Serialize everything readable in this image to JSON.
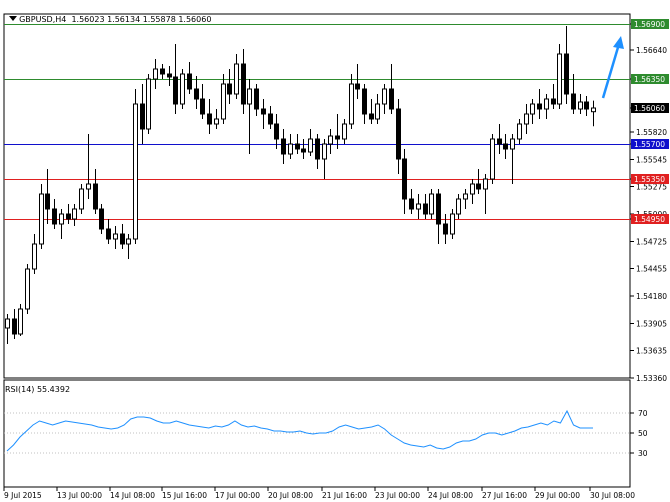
{
  "header": {
    "symbol": "GBPUSD,H4",
    "ohlc": "1.56023 1.56134 1.55878 1.56060"
  },
  "rsi": {
    "label": "RSI(14) 55.4392"
  },
  "colors": {
    "green_line": "#2e8b2e",
    "blue_line": "#1010cc",
    "red_line": "#e02020",
    "rsi_line": "#1e90ff",
    "arrow": "#1e90ff",
    "candle": "#000000",
    "grid": "#c0c0c0"
  },
  "chart_data": [
    {
      "type": "candlestick",
      "title": "GBPUSD,H4",
      "ylim": [
        1.5336,
        1.57
      ],
      "y_ticks": [
        "1.56900",
        "1.56640",
        "1.56350",
        "1.56060",
        "1.55820",
        "1.55700",
        "1.55545",
        "1.55350",
        "1.55275",
        "1.55000",
        "1.54950",
        "1.54725",
        "1.54455",
        "1.54180",
        "1.53905",
        "1.53635",
        "1.53360"
      ],
      "x_ticks": [
        "9 Jul 2015",
        "13 Jul 00:00",
        "14 Jul 08:00",
        "15 Jul 16:00",
        "17 Jul 00:00",
        "20 Jul 08:00",
        "21 Jul 16:00",
        "23 Jul 00:00",
        "24 Jul 08:00",
        "27 Jul 16:00",
        "29 Jul 00:00",
        "30 Jul 08:00"
      ],
      "levels": [
        {
          "value": 1.569,
          "label": "1.56900",
          "color": "green"
        },
        {
          "value": 1.5635,
          "label": "1.56350",
          "color": "green"
        },
        {
          "value": 1.557,
          "label": "1.55700",
          "color": "blue"
        },
        {
          "value": 1.5535,
          "label": "1.55350",
          "color": "red"
        },
        {
          "value": 1.5495,
          "label": "1.54950",
          "color": "red"
        }
      ],
      "current_price": {
        "value": 1.5606,
        "label": "1.56060"
      },
      "candles": [
        [
          1.5386,
          1.54,
          1.537,
          1.5395
        ],
        [
          1.5395,
          1.5405,
          1.5375,
          1.538
        ],
        [
          1.538,
          1.541,
          1.5378,
          1.5405
        ],
        [
          1.5405,
          1.545,
          1.54,
          1.5445
        ],
        [
          1.5445,
          1.548,
          1.544,
          1.547
        ],
        [
          1.547,
          1.553,
          1.5465,
          1.552
        ],
        [
          1.552,
          1.5545,
          1.549,
          1.5505
        ],
        [
          1.5505,
          1.5515,
          1.5485,
          1.549
        ],
        [
          1.549,
          1.5505,
          1.5475,
          1.55
        ],
        [
          1.55,
          1.551,
          1.549,
          1.5495
        ],
        [
          1.5495,
          1.551,
          1.5488,
          1.5505
        ],
        [
          1.5505,
          1.553,
          1.55,
          1.5525
        ],
        [
          1.5525,
          1.558,
          1.5515,
          1.553
        ],
        [
          1.553,
          1.5545,
          1.55,
          1.5505
        ],
        [
          1.5505,
          1.551,
          1.548,
          1.5485
        ],
        [
          1.5485,
          1.5495,
          1.547,
          1.5475
        ],
        [
          1.5475,
          1.5488,
          1.5465,
          1.548
        ],
        [
          1.548,
          1.549,
          1.5465,
          1.547
        ],
        [
          1.547,
          1.548,
          1.5455,
          1.5475
        ],
        [
          1.5475,
          1.5625,
          1.547,
          1.561
        ],
        [
          1.561,
          1.563,
          1.557,
          1.5585
        ],
        [
          1.5585,
          1.564,
          1.558,
          1.5635
        ],
        [
          1.5635,
          1.5655,
          1.5625,
          1.5645
        ],
        [
          1.5645,
          1.565,
          1.5635,
          1.564
        ],
        [
          1.564,
          1.5648,
          1.5628,
          1.5637
        ],
        [
          1.5637,
          1.567,
          1.56,
          1.561
        ],
        [
          1.561,
          1.5645,
          1.5605,
          1.564
        ],
        [
          1.564,
          1.5652,
          1.562,
          1.5625
        ],
        [
          1.5625,
          1.5638,
          1.5605,
          1.5615
        ],
        [
          1.5615,
          1.563,
          1.5595,
          1.56
        ],
        [
          1.56,
          1.5615,
          1.558,
          1.559
        ],
        [
          1.559,
          1.5605,
          1.5585,
          1.5595
        ],
        [
          1.5595,
          1.564,
          1.559,
          1.563
        ],
        [
          1.563,
          1.5645,
          1.561,
          1.562
        ],
        [
          1.562,
          1.566,
          1.5615,
          1.565
        ],
        [
          1.565,
          1.5665,
          1.56,
          1.561
        ],
        [
          1.561,
          1.5635,
          1.556,
          1.5625
        ],
        [
          1.5625,
          1.563,
          1.5598,
          1.5605
        ],
        [
          1.5605,
          1.5615,
          1.5585,
          1.56
        ],
        [
          1.56,
          1.5608,
          1.5585,
          1.559
        ],
        [
          1.559,
          1.56,
          1.5565,
          1.5575
        ],
        [
          1.5575,
          1.5585,
          1.555,
          1.556
        ],
        [
          1.556,
          1.558,
          1.5555,
          1.557
        ],
        [
          1.557,
          1.558,
          1.556,
          1.5565
        ],
        [
          1.5565,
          1.5575,
          1.5555,
          1.5562
        ],
        [
          1.5562,
          1.5585,
          1.5558,
          1.5575
        ],
        [
          1.5575,
          1.558,
          1.5545,
          1.5555
        ],
        [
          1.5555,
          1.5575,
          1.5535,
          1.557
        ],
        [
          1.557,
          1.5585,
          1.556,
          1.5578
        ],
        [
          1.5578,
          1.56,
          1.5565,
          1.5575
        ],
        [
          1.5575,
          1.5595,
          1.557,
          1.559
        ],
        [
          1.559,
          1.564,
          1.5585,
          1.563
        ],
        [
          1.563,
          1.565,
          1.5615,
          1.5625
        ],
        [
          1.5625,
          1.563,
          1.559,
          1.56
        ],
        [
          1.56,
          1.5615,
          1.559,
          1.5595
        ],
        [
          1.5595,
          1.562,
          1.559,
          1.561
        ],
        [
          1.561,
          1.563,
          1.56,
          1.5625
        ],
        [
          1.5625,
          1.565,
          1.56,
          1.5605
        ],
        [
          1.5605,
          1.5615,
          1.554,
          1.5555
        ],
        [
          1.5555,
          1.5565,
          1.55,
          1.5515
        ],
        [
          1.5515,
          1.5525,
          1.55,
          1.5505
        ],
        [
          1.5505,
          1.552,
          1.5495,
          1.551
        ],
        [
          1.551,
          1.552,
          1.5495,
          1.55
        ],
        [
          1.55,
          1.5525,
          1.5495,
          1.552
        ],
        [
          1.552,
          1.5525,
          1.547,
          1.549
        ],
        [
          1.549,
          1.55,
          1.547,
          1.548
        ],
        [
          1.548,
          1.5505,
          1.5475,
          1.55
        ],
        [
          1.55,
          1.552,
          1.5495,
          1.5515
        ],
        [
          1.5515,
          1.5525,
          1.5505,
          1.552
        ],
        [
          1.552,
          1.5535,
          1.551,
          1.553
        ],
        [
          1.553,
          1.5545,
          1.552,
          1.5525
        ],
        [
          1.5525,
          1.554,
          1.55,
          1.5535
        ],
        [
          1.5535,
          1.558,
          1.553,
          1.5575
        ],
        [
          1.5575,
          1.559,
          1.556,
          1.557
        ],
        [
          1.557,
          1.558,
          1.5555,
          1.5565
        ],
        [
          1.5565,
          1.558,
          1.553,
          1.5575
        ],
        [
          1.5575,
          1.5595,
          1.557,
          1.559
        ],
        [
          1.559,
          1.561,
          1.558,
          1.56
        ],
        [
          1.56,
          1.5615,
          1.559,
          1.561
        ],
        [
          1.561,
          1.5625,
          1.5595,
          1.5605
        ],
        [
          1.5605,
          1.562,
          1.5595,
          1.5615
        ],
        [
          1.5615,
          1.563,
          1.5605,
          1.561
        ],
        [
          1.561,
          1.567,
          1.5605,
          1.566
        ],
        [
          1.566,
          1.5688,
          1.561,
          1.562
        ],
        [
          1.562,
          1.564,
          1.56,
          1.5605
        ],
        [
          1.5605,
          1.562,
          1.56,
          1.5612
        ],
        [
          1.5612,
          1.5618,
          1.5598,
          1.5605
        ],
        [
          1.56023,
          1.56134,
          1.55878,
          1.5606
        ]
      ]
    },
    {
      "type": "line",
      "title": "RSI(14) 55.4392",
      "ylim": [
        0,
        100
      ],
      "y_ticks": [
        "70",
        "50",
        "30"
      ],
      "values": [
        32,
        38,
        46,
        52,
        58,
        62,
        60,
        58,
        60,
        62,
        61,
        60,
        59,
        58,
        56,
        55,
        54,
        55,
        58,
        64,
        66,
        66,
        65,
        62,
        60,
        60,
        62,
        60,
        58,
        57,
        56,
        55,
        57,
        56,
        58,
        62,
        58,
        56,
        57,
        55,
        54,
        52,
        52,
        51,
        51,
        52,
        50,
        49,
        50,
        50,
        52,
        56,
        58,
        56,
        54,
        55,
        56,
        58,
        54,
        48,
        44,
        40,
        38,
        37,
        36,
        38,
        35,
        34,
        36,
        40,
        42,
        42,
        44,
        48,
        50,
        50,
        48,
        50,
        52,
        55,
        56,
        58,
        60,
        58,
        62,
        60,
        72,
        58,
        55,
        55,
        55
      ]
    }
  ]
}
